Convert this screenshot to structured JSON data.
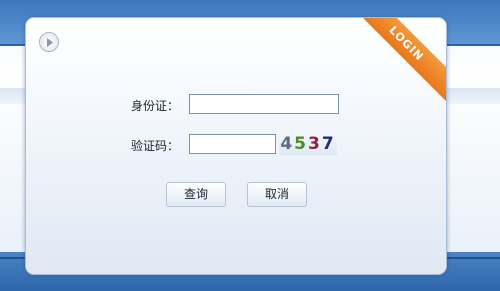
{
  "form": {
    "id_label": "身份证：",
    "id_value": "",
    "code_label": "验证码：",
    "code_value": "",
    "captcha_digits": [
      "4",
      "5",
      "3",
      "7"
    ]
  },
  "badge": {
    "text": "LOGIN"
  },
  "buttons": {
    "query": "查询",
    "cancel": "取消"
  },
  "colors": {
    "ribbon": "#e8771c",
    "band": "#3d78be"
  },
  "icons": {
    "play": "play-icon"
  }
}
